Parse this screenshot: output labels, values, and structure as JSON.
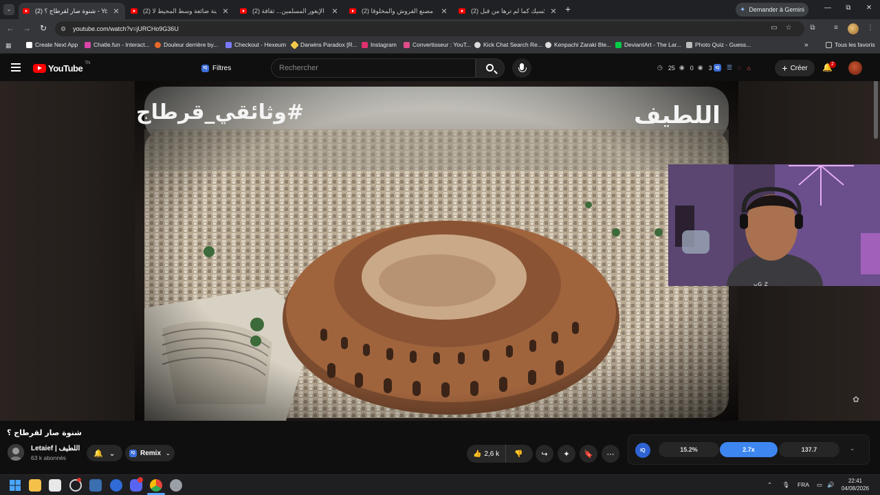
{
  "browser": {
    "tabs": [
      {
        "title": "(2) شنوة صار لقرطاج ؟ - YouTube",
        "active": true
      },
      {
        "title": "(2) مدينة ضائعة وسط المحيط لا",
        "active": false
      },
      {
        "title": "(2) أكل الإيغور المسلمين... ثقافة",
        "active": false
      },
      {
        "title": "(2) دخلنا مصنع القروش والمخلوقا",
        "active": false
      },
      {
        "title": "(2) المكسيك كما لم ترها من قبل..",
        "active": false
      }
    ],
    "tab_close_glyph": "✕",
    "new_tab_glyph": "+",
    "tablist_glyph": "⌄",
    "gemini_label": "Demander à Gemini",
    "window_controls": {
      "minimize": "—",
      "restore": "⧉",
      "close": "✕"
    },
    "nav": {
      "back": "←",
      "forward": "→",
      "reload": "↻"
    },
    "url": "youtube.com/watch?v=jURCHo9G36U",
    "bookmarks": [
      {
        "label": "Create Next App",
        "color": "#ffffff"
      },
      {
        "label": "Chatle.fun - Interact...",
        "color": "#d946a8"
      },
      {
        "label": "Douleur derrière by...",
        "color": "#e86a2a"
      },
      {
        "label": "Checkout - Hexeum",
        "color": "#7a7aff"
      },
      {
        "label": "Darwins Paradox [R...",
        "color": "#f2c94c"
      },
      {
        "label": "Instagram",
        "color": "#e1306c"
      },
      {
        "label": "Convertisseur : YouT...",
        "color": "#e04b8a"
      },
      {
        "label": "Kick Chat Search Re...",
        "color": "#dddddd"
      },
      {
        "label": "Kenpachi Zaraki Ble...",
        "color": "#dddddd"
      },
      {
        "label": "DeviantArt - The Lar...",
        "color": "#05cc47"
      },
      {
        "label": "Photo Quiz - Guess...",
        "color": "#bbbbbb"
      }
    ],
    "bookmarks_overflow": "»",
    "all_bookmarks": "Tous les favoris"
  },
  "youtube": {
    "logo_text": "YouTube",
    "logo_suffix": "TN",
    "iq_badge": "IQ",
    "filters_label": "Filtres",
    "search_placeholder": "Rechercher",
    "counters": [
      {
        "icon": "clock-icon",
        "glyph": "◷",
        "value": "25"
      },
      {
        "icon": "eye-icon",
        "glyph": "◉",
        "value": "0"
      },
      {
        "icon": "eye-icon",
        "glyph": "◉",
        "value": "3"
      }
    ],
    "create_label": "Créer",
    "create_glyph": "+",
    "notifications_count": "2"
  },
  "video": {
    "overlay_right": "اللطيف",
    "overlay_left": "#وثائقي_قرطاج",
    "title": "شنوة صار لقرطاج ؟",
    "channel_name": "Letaief | اللطيف",
    "subscribers": "63 k abonnés",
    "remix_label": "Remix",
    "likes": "2,6 k",
    "bell_glyph": "🔔",
    "chevron_glyph": "⌄",
    "like_glyph": "👍",
    "dislike_glyph": "👎",
    "share_glyph": "↪",
    "ask_glyph": "✦",
    "save_glyph": "🔖",
    "more_glyph": "⋯",
    "accent": "#ff0000"
  },
  "speed_panel": {
    "iq_label": "IQ",
    "chips": [
      {
        "label": "15.2%",
        "on": false
      },
      {
        "label": "2.7x",
        "on": true
      },
      {
        "label": "137.7",
        "on": false
      }
    ],
    "chevron": "⌄",
    "accent": "#3d86f0"
  },
  "taskbar": {
    "language": "FRA",
    "time": "22:41",
    "date": "04/08/2026",
    "chevron": "⌃"
  }
}
